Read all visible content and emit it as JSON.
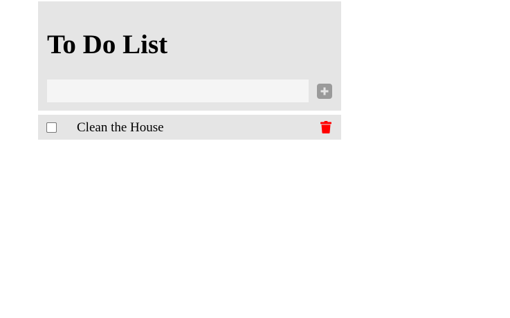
{
  "app": {
    "title": "To Do List"
  },
  "new_task": {
    "value": "",
    "placeholder": ""
  },
  "todos": [
    {
      "text": "Clean the House",
      "checked": false
    }
  ],
  "icons": {
    "add": "plus-icon",
    "delete": "trash-icon"
  },
  "colors": {
    "panel": "#e5e5e5",
    "input": "#f5f5f5",
    "add_button": "#9a9a9a",
    "delete_icon": "#ff0000"
  }
}
